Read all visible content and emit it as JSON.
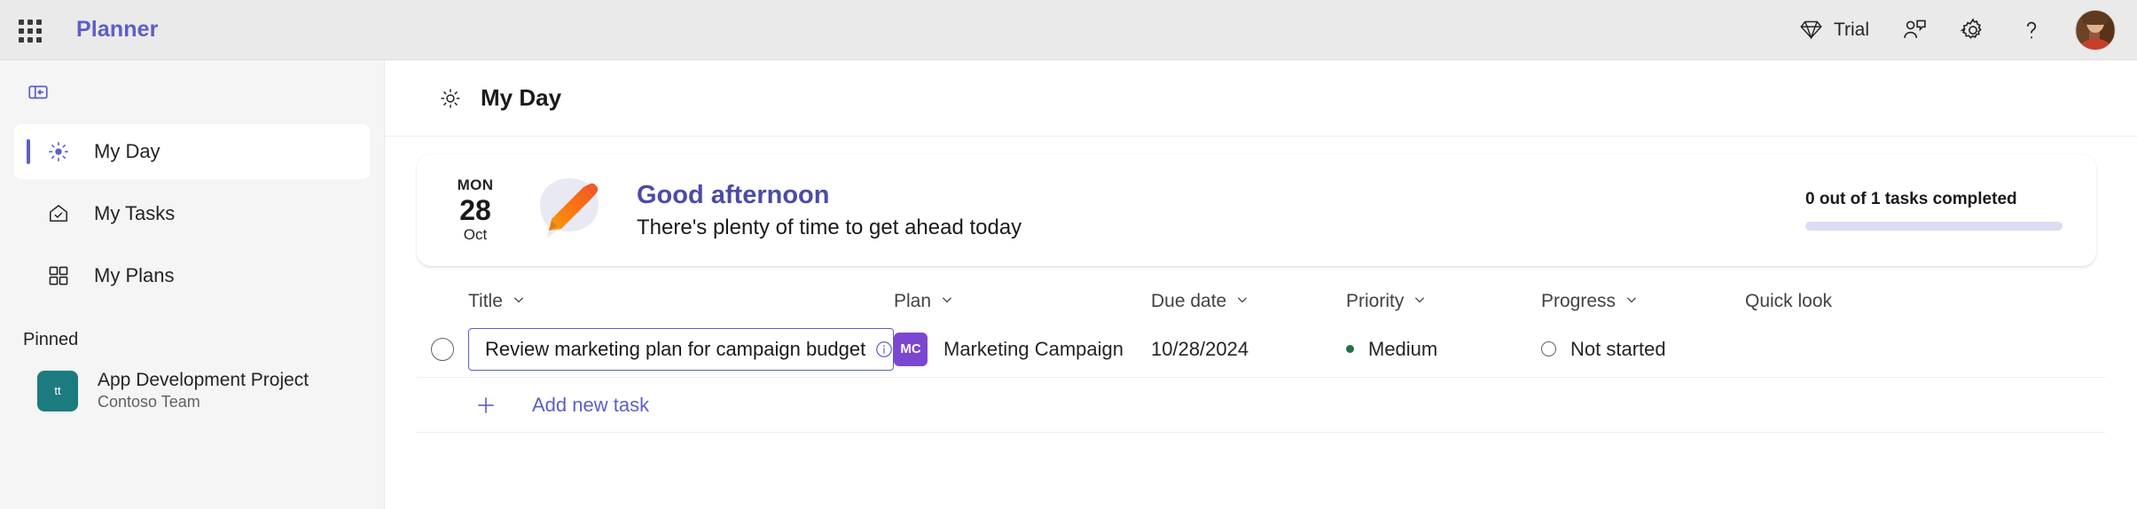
{
  "header": {
    "app_launcher_icon": "waffle-grid-icon",
    "app_name": "Planner",
    "trial_label": "Trial",
    "trial_icon": "diamond-icon",
    "feedback_icon": "feedback-person-icon",
    "settings_icon": "gear-icon",
    "help_label": "?",
    "help_icon": "question-mark-icon",
    "avatar_icon": "user-avatar",
    "background": "#eaeaea",
    "brand_color": "#5b5fc7"
  },
  "sidebar": {
    "collapse_icon": "panel-collapse-icon",
    "items": [
      {
        "label": "My Day",
        "icon": "sun-icon",
        "selected": true
      },
      {
        "label": "My Tasks",
        "icon": "tasks-home-check-icon",
        "selected": false
      },
      {
        "label": "My Plans",
        "icon": "grid-squares-icon",
        "selected": false
      }
    ],
    "pinned_heading": "Pinned",
    "pinned": [
      {
        "badge": "tt",
        "badge_color": "#1b7b7e",
        "name": "App Development Project",
        "subtitle": "Contoso Team"
      }
    ]
  },
  "page": {
    "title": "My Day",
    "title_icon": "sun-icon"
  },
  "banner": {
    "day_of_week": "MON",
    "day_number": "28",
    "month": "Oct",
    "illustration_icon": "pencil-speech-bubble-illustration",
    "greeting": "Good afternoon",
    "subtitle": "There's plenty of time to get ahead today",
    "progress_label": "0 out of 1 tasks completed",
    "progress_percent": 0,
    "progress_track_color": "#dcdcf5",
    "greeting_color": "#4b4ba6"
  },
  "table": {
    "columns": [
      {
        "key": "title",
        "label": "Title",
        "sortable": true
      },
      {
        "key": "plan",
        "label": "Plan",
        "sortable": true
      },
      {
        "key": "due",
        "label": "Due date",
        "sortable": true
      },
      {
        "key": "priority",
        "label": "Priority",
        "sortable": true
      },
      {
        "key": "progress",
        "label": "Progress",
        "sortable": true
      },
      {
        "key": "quick",
        "label": "Quick look",
        "sortable": false
      }
    ],
    "rows": [
      {
        "checked": false,
        "title": "Review marketing plan for campaign budget",
        "info_icon": "info-circle-icon",
        "more_icon": "more-vertical-icon",
        "plan_badge": "MC",
        "plan_badge_color": "#7b47d1",
        "plan": "Marketing Campaign",
        "due_date": "10/28/2024",
        "priority": "Medium",
        "priority_color": "#217346",
        "progress": "Not started",
        "quick_look": ""
      }
    ],
    "add_task_label": "Add new task",
    "add_task_icon": "plus-icon"
  }
}
